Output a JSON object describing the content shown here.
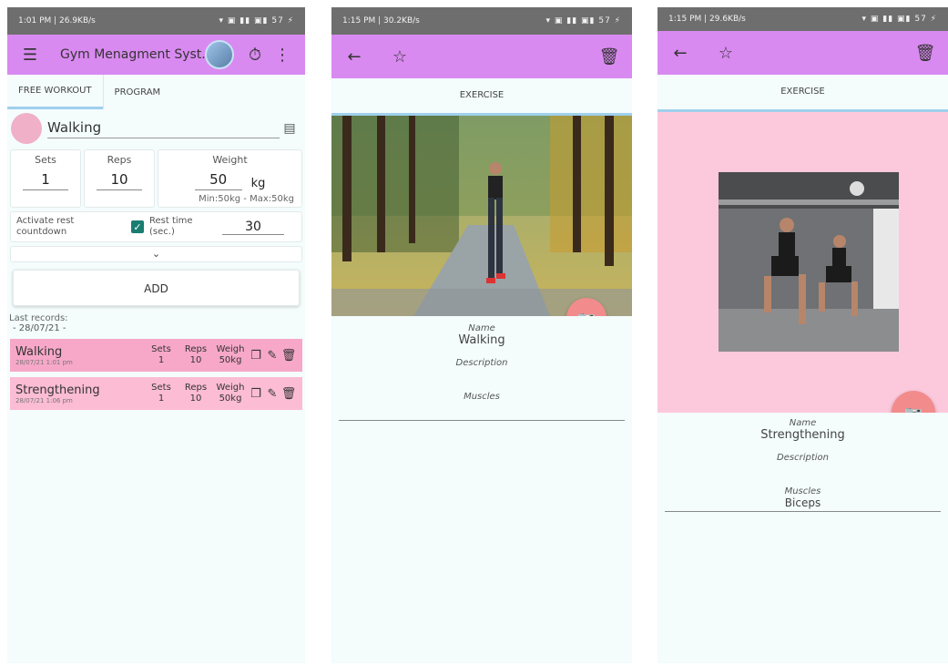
{
  "screen1": {
    "status": {
      "left": "1:01 PM | 26.9KB/s",
      "right": "▾ ▣ ▮▮ ▣▮ 57 ⚡"
    },
    "appbar": {
      "title": "Gym Menagment Syst..."
    },
    "tabs": [
      "FREE WORKOUT",
      "PROGRAM"
    ],
    "exercise": "Walking",
    "sets": {
      "label": "Sets",
      "value": "1"
    },
    "reps": {
      "label": "Reps",
      "value": "10"
    },
    "weight": {
      "label": "Weight",
      "value": "50",
      "unit": "kg",
      "minmax": "Min:50kg - Max:50kg"
    },
    "rest": {
      "activate_label": "Activate rest countdown",
      "time_label": "Rest time (sec.)",
      "value": "30"
    },
    "add_label": "ADD",
    "last_records_label": "Last records:",
    "date": "- 28/07/21 -",
    "records": [
      {
        "name": "Walking",
        "time": "28/07/21 1:01 pm",
        "sets_label": "Sets",
        "sets": "1",
        "reps_label": "Reps",
        "reps": "10",
        "weight_label": "Weigh",
        "weight": "50kg"
      },
      {
        "name": "Strengthening",
        "time": "28/07/21 1:06 pm",
        "sets_label": "Sets",
        "sets": "1",
        "reps_label": "Reps",
        "reps": "10",
        "weight_label": "Weigh",
        "weight": "50kg"
      }
    ]
  },
  "screen2": {
    "status": {
      "left": "1:15 PM | 30.2KB/s",
      "right": "▾ ▣ ▮▮ ▣▮ 57 ⚡"
    },
    "header": "EXERCISE",
    "name_label": "Name",
    "name": "Walking",
    "description_label": "Description",
    "muscles_label": "Muscles"
  },
  "screen3": {
    "status": {
      "left": "1:15 PM | 29.6KB/s",
      "right": "▾ ▣ ▮▮ ▣▮ 57 ⚡"
    },
    "header": "EXERCISE",
    "name_label": "Name",
    "name": "Strengthening",
    "description_label": "Description",
    "muscles_label": "Muscles",
    "muscles": "Biceps"
  },
  "colors": {
    "appbar": "#d98af0",
    "pink_record": "#f7a8c8",
    "pink_bg": "#fcc8dc",
    "fab": "#f28b8b",
    "check": "#1a7d72"
  },
  "icons": [
    "menu-icon",
    "timer-icon",
    "more-vert-icon",
    "list-icon",
    "chevron-down-icon",
    "copy-icon",
    "edit-icon",
    "delete-icon",
    "back-arrow-icon",
    "star-icon",
    "camera-icon"
  ]
}
